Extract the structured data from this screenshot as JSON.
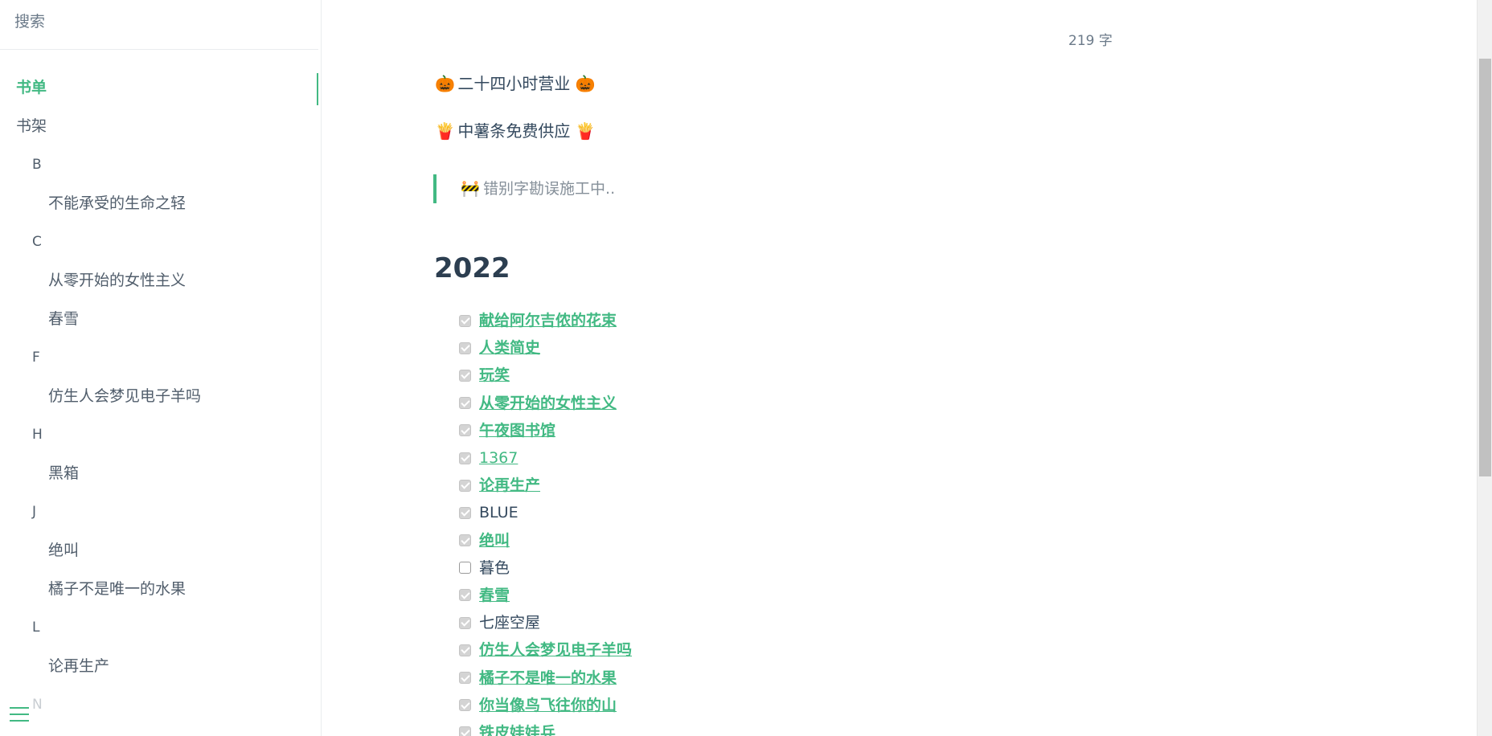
{
  "search": {
    "placeholder": "搜索"
  },
  "sidebar": {
    "items": [
      {
        "label": "书单",
        "level": 0,
        "active": true
      },
      {
        "label": "书架",
        "level": 0
      },
      {
        "label": "B",
        "level": 1
      },
      {
        "label": "不能承受的生命之轻",
        "level": 2
      },
      {
        "label": "C",
        "level": 1
      },
      {
        "label": "从零开始的女性主义",
        "level": 2
      },
      {
        "label": "春雪",
        "level": 2
      },
      {
        "label": "F",
        "level": 1
      },
      {
        "label": "仿生人会梦见电子羊吗",
        "level": 2
      },
      {
        "label": "H",
        "level": 1
      },
      {
        "label": "黑箱",
        "level": 2
      },
      {
        "label": "J",
        "level": 1
      },
      {
        "label": "绝叫",
        "level": 2
      },
      {
        "label": "橘子不是唯一的水果",
        "level": 2
      },
      {
        "label": "L",
        "level": 1
      },
      {
        "label": "论再生产",
        "level": 2
      },
      {
        "label": "N",
        "level": 1,
        "faded": true
      }
    ]
  },
  "main": {
    "word_count": "219 字",
    "line1": {
      "emoji": "🎃",
      "text": "二十四小时营业"
    },
    "line2": {
      "emoji": "🍟",
      "text": "中薯条免费供应"
    },
    "notice": {
      "emoji": "🚧",
      "text": "错别字勘误施工中.."
    },
    "year": "2022",
    "books": [
      {
        "title": "献给阿尔吉侬的花束",
        "checked": true,
        "link": true
      },
      {
        "title": "人类简史",
        "checked": true,
        "link": true
      },
      {
        "title": "玩笑",
        "checked": true,
        "link": true
      },
      {
        "title": "从零开始的女性主义",
        "checked": true,
        "link": true
      },
      {
        "title": "午夜图书馆",
        "checked": true,
        "link": true
      },
      {
        "title": "1367",
        "checked": true,
        "link": true
      },
      {
        "title": "论再生产",
        "checked": true,
        "link": true
      },
      {
        "title": "BLUE",
        "checked": true,
        "link": false
      },
      {
        "title": "绝叫",
        "checked": true,
        "link": true
      },
      {
        "title": "暮色",
        "checked": false,
        "link": false
      },
      {
        "title": "春雪",
        "checked": true,
        "link": true
      },
      {
        "title": "七座空屋",
        "checked": true,
        "link": false
      },
      {
        "title": "仿生人会梦见电子羊吗",
        "checked": true,
        "link": true
      },
      {
        "title": "橘子不是唯一的水果",
        "checked": true,
        "link": true
      },
      {
        "title": "你当像鸟飞往你的山",
        "checked": true,
        "link": true
      },
      {
        "title": "铁皮娃娃兵",
        "checked": true,
        "link": true
      }
    ]
  },
  "colors": {
    "accent": "#42b983",
    "text": "#34495e",
    "heading": "#2c3e50"
  }
}
